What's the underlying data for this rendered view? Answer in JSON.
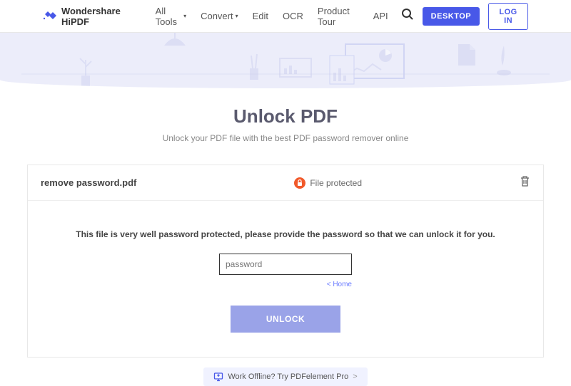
{
  "header": {
    "brand": "Wondershare HiPDF",
    "nav": {
      "all_tools": "All Tools",
      "convert": "Convert",
      "edit": "Edit",
      "ocr": "OCR",
      "product_tour": "Product Tour",
      "api": "API"
    },
    "desktop_btn": "DESKTOP",
    "login_btn": "LOG IN"
  },
  "main": {
    "title": "Unlock PDF",
    "subtitle": "Unlock your PDF file with the best PDF password remover online"
  },
  "panel": {
    "filename": "remove password.pdf",
    "status": "File protected",
    "instruction": "This file is very well password protected, please provide the password so that we can unlock it for you.",
    "password_placeholder": "password",
    "home_link": "< Home",
    "unlock_btn": "UNLOCK"
  },
  "offline": {
    "text": "Work Offline? Try PDFelement Pro",
    "arrow": ">"
  }
}
